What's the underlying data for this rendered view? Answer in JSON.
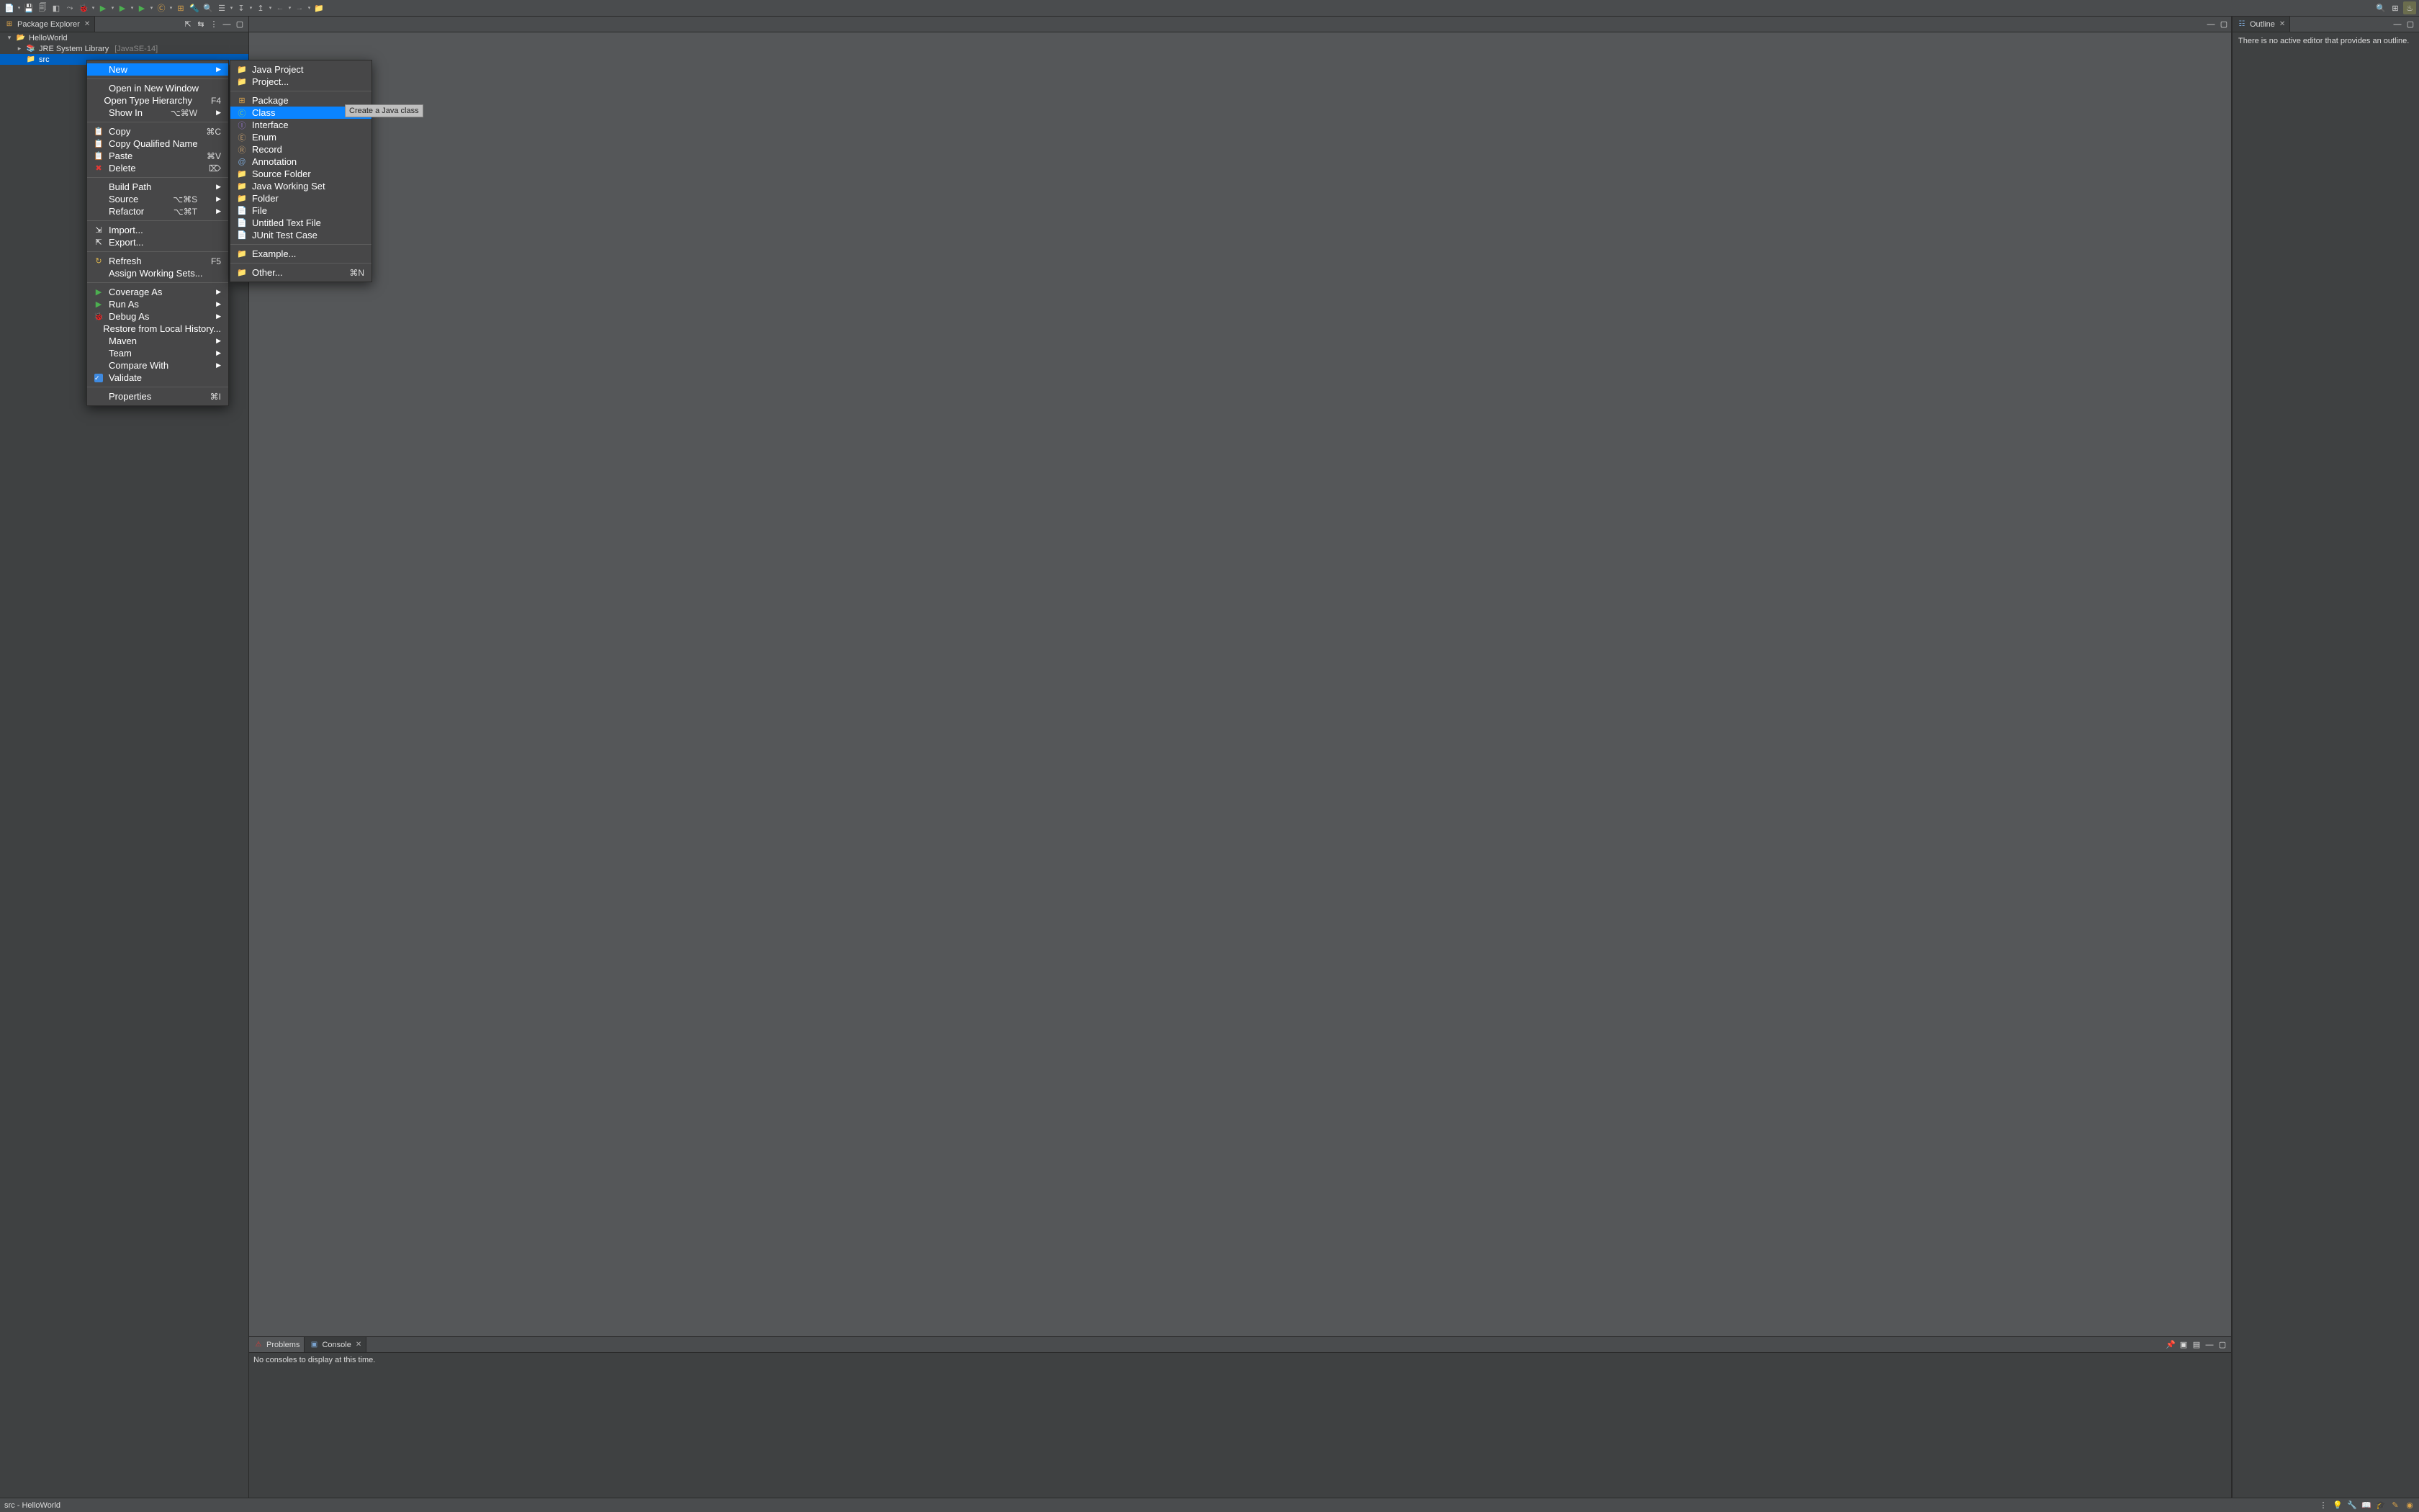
{
  "toolbar_icons": [
    {
      "name": "new-wizard",
      "glyph": "📄",
      "color": "#e0b84e"
    },
    {
      "name": "save",
      "glyph": "💾",
      "color": "#bbb"
    },
    {
      "name": "save-all",
      "glyph": "🗐",
      "color": "#bbb"
    },
    {
      "name": "toggle-breadcrumb",
      "glyph": "◧",
      "color": "#bbb"
    },
    {
      "name": "skip-breakpoints",
      "glyph": "⤳",
      "color": "#bbb"
    },
    {
      "name": "debug",
      "glyph": "🐞",
      "color": "#8bc34a"
    },
    {
      "name": "run",
      "glyph": "▶",
      "color": "#4caf50"
    },
    {
      "name": "coverage",
      "glyph": "▶",
      "color": "#4caf50"
    },
    {
      "name": "run-last",
      "glyph": "▶",
      "color": "#4caf50"
    },
    {
      "name": "new-java-class",
      "glyph": "Ⓒ",
      "color": "#d9a24a"
    },
    {
      "name": "new-java-package",
      "glyph": "⊞",
      "color": "#d9a24a"
    },
    {
      "name": "open-type",
      "glyph": "🔦",
      "color": "#e0b84e"
    },
    {
      "name": "search",
      "glyph": "🔍",
      "color": "#e0b84e"
    },
    {
      "name": "toggle-mark",
      "glyph": "☰",
      "color": "#bbb"
    },
    {
      "name": "next-annotation",
      "glyph": "↧",
      "color": "#bbb"
    },
    {
      "name": "prev-annotation",
      "glyph": "↥",
      "color": "#bbb"
    },
    {
      "name": "back",
      "glyph": "←",
      "color": "#888"
    },
    {
      "name": "forward",
      "glyph": "→",
      "color": "#888"
    },
    {
      "name": "pin",
      "glyph": "📁",
      "color": "#bbb"
    }
  ],
  "toolbar_right": [
    {
      "name": "quick-access",
      "glyph": "🔍"
    },
    {
      "name": "open-perspective",
      "glyph": "⊞"
    },
    {
      "name": "java-perspective",
      "glyph": "♨"
    }
  ],
  "package_explorer": {
    "title": "Package Explorer",
    "actions": [
      "collapse-all",
      "link-editor",
      "view-menu",
      "minimize",
      "maximize"
    ],
    "tree": {
      "project": "HelloWorld",
      "jre_label": "JRE System Library",
      "jre_env": "[JavaSE-14]",
      "src": "src"
    }
  },
  "editor_actions": [
    "minimize",
    "maximize"
  ],
  "outline": {
    "title": "Outline",
    "message": "There is no active editor that provides an outline.",
    "actions": [
      "minimize",
      "maximize"
    ]
  },
  "bottom": {
    "tabs": [
      {
        "id": "problems",
        "label": "Problems",
        "icon": "⚠"
      },
      {
        "id": "console",
        "label": "Console",
        "icon": "▣",
        "active": true
      }
    ],
    "console_message": "No consoles to display at this time.",
    "actions": [
      "pin-console",
      "display-console",
      "open-console",
      "minimize",
      "maximize"
    ]
  },
  "statusbar": {
    "left": "src - HelloWorld",
    "right_icons": [
      "separator",
      "tip-of-day",
      "samples",
      "tutorials",
      "whats-new",
      "updates",
      "overview"
    ]
  },
  "context_menu_1": [
    {
      "type": "item",
      "label": "New",
      "submenu": true,
      "highlight": true
    },
    {
      "type": "sep"
    },
    {
      "type": "item",
      "label": "Open in New Window"
    },
    {
      "type": "item",
      "label": "Open Type Hierarchy",
      "shortcut": "F4"
    },
    {
      "type": "item",
      "label": "Show In",
      "shortcut": "⌥⌘W",
      "submenu": true
    },
    {
      "type": "sep"
    },
    {
      "type": "item",
      "label": "Copy",
      "shortcut": "⌘C",
      "icon": "📋"
    },
    {
      "type": "item",
      "label": "Copy Qualified Name",
      "icon": "📋"
    },
    {
      "type": "item",
      "label": "Paste",
      "shortcut": "⌘V",
      "icon": "📋"
    },
    {
      "type": "item",
      "label": "Delete",
      "shortcut": "⌦",
      "icon": "✖",
      "iconColor": "#e53935"
    },
    {
      "type": "sep"
    },
    {
      "type": "item",
      "label": "Build Path",
      "submenu": true
    },
    {
      "type": "item",
      "label": "Source",
      "shortcut": "⌥⌘S",
      "submenu": true
    },
    {
      "type": "item",
      "label": "Refactor",
      "shortcut": "⌥⌘T",
      "submenu": true
    },
    {
      "type": "sep"
    },
    {
      "type": "item",
      "label": "Import...",
      "icon": "⇲"
    },
    {
      "type": "item",
      "label": "Export...",
      "icon": "⇱"
    },
    {
      "type": "sep"
    },
    {
      "type": "item",
      "label": "Refresh",
      "shortcut": "F5",
      "icon": "↻",
      "iconColor": "#e0b84e"
    },
    {
      "type": "item",
      "label": "Assign Working Sets..."
    },
    {
      "type": "sep"
    },
    {
      "type": "item",
      "label": "Coverage As",
      "submenu": true,
      "icon": "▶",
      "iconColor": "#4caf50"
    },
    {
      "type": "item",
      "label": "Run As",
      "submenu": true,
      "icon": "▶",
      "iconColor": "#4caf50"
    },
    {
      "type": "item",
      "label": "Debug As",
      "submenu": true,
      "icon": "🐞",
      "iconColor": "#8bc34a"
    },
    {
      "type": "item",
      "label": "Restore from Local History..."
    },
    {
      "type": "item",
      "label": "Maven",
      "submenu": true
    },
    {
      "type": "item",
      "label": "Team",
      "submenu": true
    },
    {
      "type": "item",
      "label": "Compare With",
      "submenu": true
    },
    {
      "type": "item",
      "label": "Validate",
      "icon": "validate"
    },
    {
      "type": "sep"
    },
    {
      "type": "item",
      "label": "Properties",
      "shortcut": "⌘I"
    }
  ],
  "context_menu_2": [
    {
      "type": "item",
      "label": "Java Project",
      "icon": "📁",
      "iconColor": "#d9a24a"
    },
    {
      "type": "item",
      "label": "Project...",
      "icon": "📁",
      "iconColor": "#bbb"
    },
    {
      "type": "sep"
    },
    {
      "type": "item",
      "label": "Package",
      "icon": "⊞",
      "iconColor": "#d9a24a"
    },
    {
      "type": "item",
      "label": "Class",
      "icon": "Ⓒ",
      "iconColor": "#7fc97f",
      "highlight": true
    },
    {
      "type": "item",
      "label": "Interface",
      "icon": "Ⓘ",
      "iconColor": "#9575cd"
    },
    {
      "type": "item",
      "label": "Enum",
      "icon": "Ⓔ",
      "iconColor": "#c19a6b"
    },
    {
      "type": "item",
      "label": "Record",
      "icon": "Ⓡ",
      "iconColor": "#c19a6b"
    },
    {
      "type": "item",
      "label": "Annotation",
      "icon": "@",
      "iconColor": "#7aa3cf"
    },
    {
      "type": "item",
      "label": "Source Folder",
      "icon": "📁",
      "iconColor": "#d9a24a"
    },
    {
      "type": "item",
      "label": "Java Working Set",
      "icon": "📁",
      "iconColor": "#d9a24a"
    },
    {
      "type": "item",
      "label": "Folder",
      "icon": "📁",
      "iconColor": "#e0b84e"
    },
    {
      "type": "item",
      "label": "File",
      "icon": "📄",
      "iconColor": "#bbb"
    },
    {
      "type": "item",
      "label": "Untitled Text File",
      "icon": "📄",
      "iconColor": "#bbb"
    },
    {
      "type": "item",
      "label": "JUnit Test Case",
      "icon": "📄",
      "iconColor": "#7aa3cf"
    },
    {
      "type": "sep"
    },
    {
      "type": "item",
      "label": "Example...",
      "icon": "📁",
      "iconColor": "#bbb"
    },
    {
      "type": "sep"
    },
    {
      "type": "item",
      "label": "Other...",
      "shortcut": "⌘N",
      "icon": "📁",
      "iconColor": "#bbb"
    }
  ],
  "tooltip": "Create a Java class"
}
